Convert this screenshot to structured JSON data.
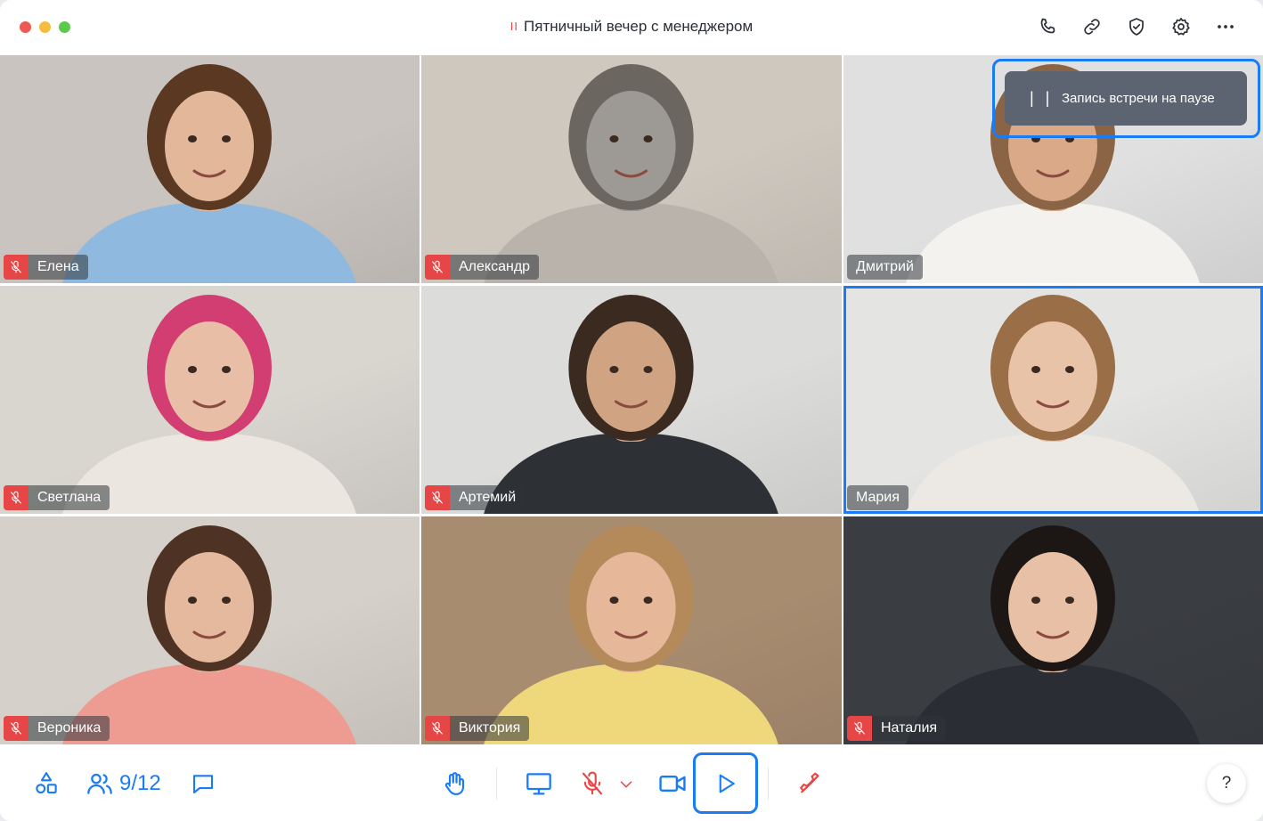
{
  "window": {
    "title": "Пятничный вечер с менеджером",
    "recording_indicator": "II",
    "traffic_lights": [
      "#ee5a52",
      "#f5bd3e",
      "#5ec84c"
    ]
  },
  "header_actions": [
    {
      "name": "phone-icon"
    },
    {
      "name": "link-icon"
    },
    {
      "name": "shield-icon"
    },
    {
      "name": "gear-icon"
    },
    {
      "name": "more-icon"
    }
  ],
  "banner": {
    "pause_glyph": "| |",
    "text": "Запись встречи на паузе"
  },
  "participants": [
    {
      "name": "Елена",
      "muted": true,
      "bg": "#c9c4bf",
      "skin": "#e2b79a",
      "hair": "#5a3822",
      "shirt": "#8fb9df"
    },
    {
      "name": "Александр",
      "muted": true,
      "bg": "#cfc8bf",
      "skin": "#9d9994",
      "hair": "#6b6660",
      "shirt": "#b9b3ab"
    },
    {
      "name": "Дмитрий",
      "muted": false,
      "bg": "#dfe0df",
      "skin": "#d9a988",
      "hair": "#8a6444",
      "shirt": "#f4f2ee"
    },
    {
      "name": "Светлана",
      "muted": true,
      "bg": "#d9d5cf",
      "skin": "#e8bfa6",
      "hair": "#d23e72",
      "shirt": "#ebe6df"
    },
    {
      "name": "Артемий",
      "muted": true,
      "bg": "#dcdcdb",
      "skin": "#d0a383",
      "hair": "#3b2a20",
      "shirt": "#2d3034"
    },
    {
      "name": "Мария",
      "muted": false,
      "bg": "#e4e4e2",
      "skin": "#e9c3a8",
      "hair": "#9a6e46",
      "shirt": "#ece9e4",
      "active": true
    },
    {
      "name": "Вероника",
      "muted": true,
      "bg": "#d5d0c9",
      "skin": "#e4b99d",
      "hair": "#4e3324",
      "shirt": "#ee9c92"
    },
    {
      "name": "Виктория",
      "muted": true,
      "bg": "#a88c70",
      "skin": "#e6b899",
      "hair": "#b58a5a",
      "shirt": "#efd77c"
    },
    {
      "name": "Наталия",
      "muted": true,
      "bg": "#3a3d42",
      "skin": "#e7c0a6",
      "hair": "#1c1715",
      "shirt": "#2a2d33"
    }
  ],
  "toolbar": {
    "participants_count": "9/12",
    "help_label": "?",
    "colors": {
      "accent": "#1a7cf5",
      "danger": "#e64646"
    }
  }
}
